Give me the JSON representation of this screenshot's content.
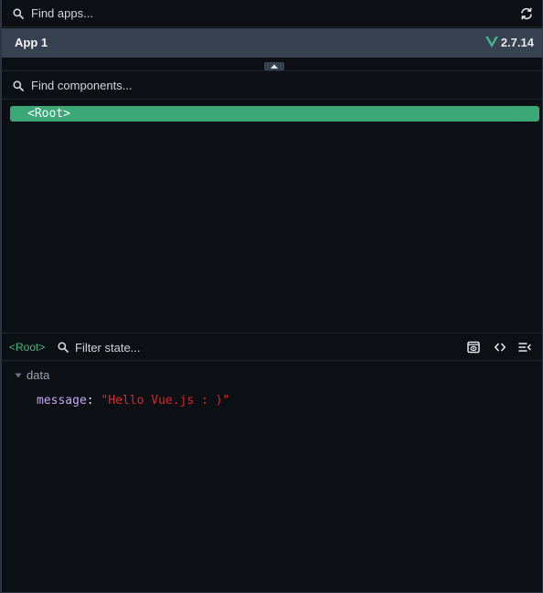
{
  "apps_search": {
    "placeholder": "Find apps..."
  },
  "app": {
    "name": "App 1",
    "framework_version": "2.7.14"
  },
  "components_search": {
    "placeholder": "Find components..."
  },
  "component_tree": {
    "root_label": "<Root>"
  },
  "inspector": {
    "selected_component": "<Root>",
    "filter_placeholder": "Filter state...",
    "sections": [
      {
        "title": "data",
        "expanded": true,
        "entries": [
          {
            "key": "message",
            "value": "\"Hello Vue.js : )\""
          }
        ]
      }
    ]
  },
  "icons": {
    "search": "search-icon",
    "refresh": "refresh-icon",
    "vue_logo": "vue-logo-icon",
    "collapse": "chevron-up-icon",
    "scroll_to_component": "scroll-to-component-icon",
    "inspect_dom": "code-icon",
    "settings_menu": "menu-icon"
  },
  "colors": {
    "vue_green": "#42b883",
    "selected_row": "#3ba776",
    "app_row_bg": "#374151",
    "state_key": "#c4a7f5",
    "string_value": "#dc2626"
  }
}
